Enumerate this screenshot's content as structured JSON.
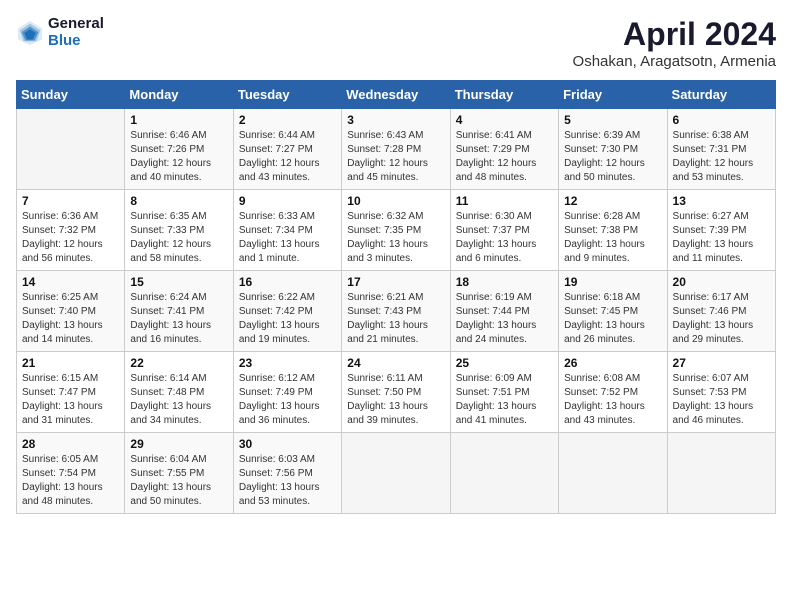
{
  "logo": {
    "general": "General",
    "blue": "Blue"
  },
  "title": "April 2024",
  "subtitle": "Oshakan, Aragatsotn, Armenia",
  "days_header": [
    "Sunday",
    "Monday",
    "Tuesday",
    "Wednesday",
    "Thursday",
    "Friday",
    "Saturday"
  ],
  "weeks": [
    [
      {
        "day": "",
        "sunrise": "",
        "sunset": "",
        "daylight": ""
      },
      {
        "day": "1",
        "sunrise": "Sunrise: 6:46 AM",
        "sunset": "Sunset: 7:26 PM",
        "daylight": "Daylight: 12 hours and 40 minutes."
      },
      {
        "day": "2",
        "sunrise": "Sunrise: 6:44 AM",
        "sunset": "Sunset: 7:27 PM",
        "daylight": "Daylight: 12 hours and 43 minutes."
      },
      {
        "day": "3",
        "sunrise": "Sunrise: 6:43 AM",
        "sunset": "Sunset: 7:28 PM",
        "daylight": "Daylight: 12 hours and 45 minutes."
      },
      {
        "day": "4",
        "sunrise": "Sunrise: 6:41 AM",
        "sunset": "Sunset: 7:29 PM",
        "daylight": "Daylight: 12 hours and 48 minutes."
      },
      {
        "day": "5",
        "sunrise": "Sunrise: 6:39 AM",
        "sunset": "Sunset: 7:30 PM",
        "daylight": "Daylight: 12 hours and 50 minutes."
      },
      {
        "day": "6",
        "sunrise": "Sunrise: 6:38 AM",
        "sunset": "Sunset: 7:31 PM",
        "daylight": "Daylight: 12 hours and 53 minutes."
      }
    ],
    [
      {
        "day": "7",
        "sunrise": "Sunrise: 6:36 AM",
        "sunset": "Sunset: 7:32 PM",
        "daylight": "Daylight: 12 hours and 56 minutes."
      },
      {
        "day": "8",
        "sunrise": "Sunrise: 6:35 AM",
        "sunset": "Sunset: 7:33 PM",
        "daylight": "Daylight: 12 hours and 58 minutes."
      },
      {
        "day": "9",
        "sunrise": "Sunrise: 6:33 AM",
        "sunset": "Sunset: 7:34 PM",
        "daylight": "Daylight: 13 hours and 1 minute."
      },
      {
        "day": "10",
        "sunrise": "Sunrise: 6:32 AM",
        "sunset": "Sunset: 7:35 PM",
        "daylight": "Daylight: 13 hours and 3 minutes."
      },
      {
        "day": "11",
        "sunrise": "Sunrise: 6:30 AM",
        "sunset": "Sunset: 7:37 PM",
        "daylight": "Daylight: 13 hours and 6 minutes."
      },
      {
        "day": "12",
        "sunrise": "Sunrise: 6:28 AM",
        "sunset": "Sunset: 7:38 PM",
        "daylight": "Daylight: 13 hours and 9 minutes."
      },
      {
        "day": "13",
        "sunrise": "Sunrise: 6:27 AM",
        "sunset": "Sunset: 7:39 PM",
        "daylight": "Daylight: 13 hours and 11 minutes."
      }
    ],
    [
      {
        "day": "14",
        "sunrise": "Sunrise: 6:25 AM",
        "sunset": "Sunset: 7:40 PM",
        "daylight": "Daylight: 13 hours and 14 minutes."
      },
      {
        "day": "15",
        "sunrise": "Sunrise: 6:24 AM",
        "sunset": "Sunset: 7:41 PM",
        "daylight": "Daylight: 13 hours and 16 minutes."
      },
      {
        "day": "16",
        "sunrise": "Sunrise: 6:22 AM",
        "sunset": "Sunset: 7:42 PM",
        "daylight": "Daylight: 13 hours and 19 minutes."
      },
      {
        "day": "17",
        "sunrise": "Sunrise: 6:21 AM",
        "sunset": "Sunset: 7:43 PM",
        "daylight": "Daylight: 13 hours and 21 minutes."
      },
      {
        "day": "18",
        "sunrise": "Sunrise: 6:19 AM",
        "sunset": "Sunset: 7:44 PM",
        "daylight": "Daylight: 13 hours and 24 minutes."
      },
      {
        "day": "19",
        "sunrise": "Sunrise: 6:18 AM",
        "sunset": "Sunset: 7:45 PM",
        "daylight": "Daylight: 13 hours and 26 minutes."
      },
      {
        "day": "20",
        "sunrise": "Sunrise: 6:17 AM",
        "sunset": "Sunset: 7:46 PM",
        "daylight": "Daylight: 13 hours and 29 minutes."
      }
    ],
    [
      {
        "day": "21",
        "sunrise": "Sunrise: 6:15 AM",
        "sunset": "Sunset: 7:47 PM",
        "daylight": "Daylight: 13 hours and 31 minutes."
      },
      {
        "day": "22",
        "sunrise": "Sunrise: 6:14 AM",
        "sunset": "Sunset: 7:48 PM",
        "daylight": "Daylight: 13 hours and 34 minutes."
      },
      {
        "day": "23",
        "sunrise": "Sunrise: 6:12 AM",
        "sunset": "Sunset: 7:49 PM",
        "daylight": "Daylight: 13 hours and 36 minutes."
      },
      {
        "day": "24",
        "sunrise": "Sunrise: 6:11 AM",
        "sunset": "Sunset: 7:50 PM",
        "daylight": "Daylight: 13 hours and 39 minutes."
      },
      {
        "day": "25",
        "sunrise": "Sunrise: 6:09 AM",
        "sunset": "Sunset: 7:51 PM",
        "daylight": "Daylight: 13 hours and 41 minutes."
      },
      {
        "day": "26",
        "sunrise": "Sunrise: 6:08 AM",
        "sunset": "Sunset: 7:52 PM",
        "daylight": "Daylight: 13 hours and 43 minutes."
      },
      {
        "day": "27",
        "sunrise": "Sunrise: 6:07 AM",
        "sunset": "Sunset: 7:53 PM",
        "daylight": "Daylight: 13 hours and 46 minutes."
      }
    ],
    [
      {
        "day": "28",
        "sunrise": "Sunrise: 6:05 AM",
        "sunset": "Sunset: 7:54 PM",
        "daylight": "Daylight: 13 hours and 48 minutes."
      },
      {
        "day": "29",
        "sunrise": "Sunrise: 6:04 AM",
        "sunset": "Sunset: 7:55 PM",
        "daylight": "Daylight: 13 hours and 50 minutes."
      },
      {
        "day": "30",
        "sunrise": "Sunrise: 6:03 AM",
        "sunset": "Sunset: 7:56 PM",
        "daylight": "Daylight: 13 hours and 53 minutes."
      },
      {
        "day": "",
        "sunrise": "",
        "sunset": "",
        "daylight": ""
      },
      {
        "day": "",
        "sunrise": "",
        "sunset": "",
        "daylight": ""
      },
      {
        "day": "",
        "sunrise": "",
        "sunset": "",
        "daylight": ""
      },
      {
        "day": "",
        "sunrise": "",
        "sunset": "",
        "daylight": ""
      }
    ]
  ]
}
